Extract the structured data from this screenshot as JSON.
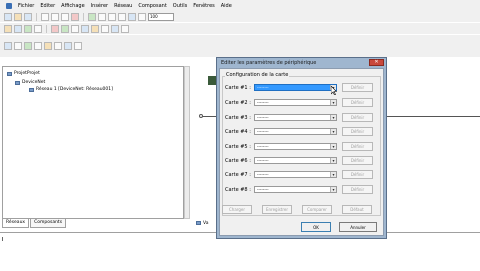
{
  "menubar": {
    "items": [
      "Fichier",
      "Editer",
      "Affichage",
      "Insérer",
      "Réseau",
      "Composant",
      "Outils",
      "Fenêtres",
      "Aide"
    ]
  },
  "toolbar": {
    "zoom_value": "100"
  },
  "project_tree": {
    "root": "ProjetProjet",
    "child": "DeviceNet",
    "leaf": "Réseau 1 [DeviceNet: Réseau001]"
  },
  "left_tabs": [
    "Réseaux",
    "Composants"
  ],
  "background": {
    "net_label_fragment": "Va"
  },
  "dialog": {
    "title": "Editer les paramètres de périphérique",
    "close_glyph": "✕",
    "group_label": "Configuration de la carte",
    "rows": [
      {
        "label": "Carte #1 :",
        "value": "--------",
        "button": "Définir"
      },
      {
        "label": "Carte #2 :",
        "value": "--------",
        "button": "Définir"
      },
      {
        "label": "Carte #3 :",
        "value": "--------",
        "button": "Définir"
      },
      {
        "label": "Carte #4 :",
        "value": "--------",
        "button": "Définir"
      },
      {
        "label": "Carte #5 :",
        "value": "--------",
        "button": "Définir"
      },
      {
        "label": "Carte #6 :",
        "value": "--------",
        "button": "Définir"
      },
      {
        "label": "Carte #7 :",
        "value": "--------",
        "button": "Définir"
      },
      {
        "label": "Carte #8 :",
        "value": "--------",
        "button": "Définir"
      }
    ],
    "bottom_buttons": [
      "Charger",
      "Enregistrer",
      "Comparer",
      "Défaut"
    ],
    "ok_label": "OK",
    "cancel_label": "Annuler"
  }
}
